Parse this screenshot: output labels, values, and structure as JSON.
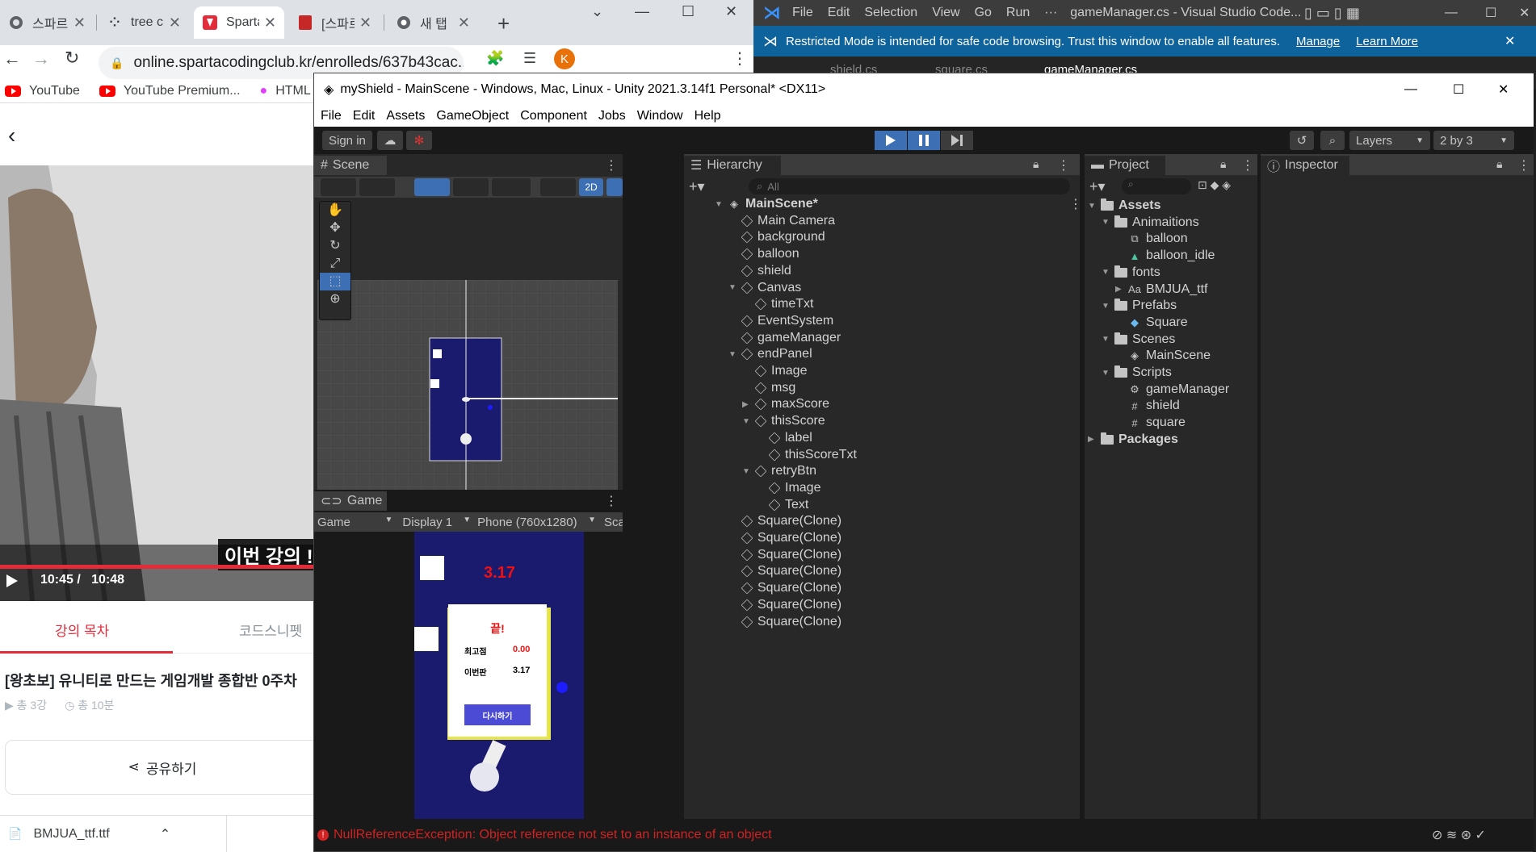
{
  "chrome": {
    "tabs": [
      {
        "label": "스파르",
        "active": false
      },
      {
        "label": "tree c",
        "active": false
      },
      {
        "label": "Sparta",
        "active": true
      },
      {
        "label": "[스파르",
        "active": false
      },
      {
        "label": "새 탭",
        "active": false
      }
    ],
    "url": "online.spartacodingclub.kr/enrolleds/637b43cac...",
    "bookmarks": [
      "YouTube",
      "YouTube Premium...",
      "HTML Tag"
    ],
    "video": {
      "caption": "이번 강의 !",
      "time_current": "10:45 /",
      "time_total": "10:48",
      "progress_fraction": 0.99
    },
    "lesson_tabs": {
      "toc": "강의 목차",
      "snippets": "코드스니펫"
    },
    "course_title": "[왕초보] 유니티로 만드는 게임개발 종합반 0주차",
    "course_meta": {
      "lessons": "총 3강",
      "duration": "총 10분"
    },
    "share_label": "공유하기",
    "download": {
      "filename": "BMJUA_ttf.ttf"
    },
    "avatar_letter": "K"
  },
  "vscode": {
    "menu": [
      "File",
      "Edit",
      "Selection",
      "View",
      "Go",
      "Run",
      "···"
    ],
    "title": "gameManager.cs - Visual Studio Code...",
    "banner": {
      "text": "Restricted Mode is intended for safe code browsing. Trust this window to enable all features.",
      "manage": "Manage",
      "learn_more": "Learn More"
    },
    "tabs": [
      "shield.cs",
      "square.cs",
      "gameManager.cs"
    ]
  },
  "unity": {
    "title": "myShield - MainScene - Windows, Mac, Linux - Unity 2021.3.14f1 Personal* <DX11>",
    "menu": [
      "File",
      "Edit",
      "Assets",
      "GameObject",
      "Component",
      "Jobs",
      "Window",
      "Help"
    ],
    "toolbar": {
      "sign_in": "Sign in",
      "layers": "Layers",
      "layout": "2 by 3"
    },
    "scene_tab": "Scene",
    "scene_2d_label": "2D",
    "game_tab": "Game",
    "game_bar": {
      "mode": "Game",
      "display": "Display 1",
      "resolution": "Phone (760x1280)",
      "scale": "Sca"
    },
    "game": {
      "timer": "3.17",
      "panel_title": "끝!",
      "best_label": "최고점",
      "best_value": "0.00",
      "this_label": "이번판",
      "this_value": "3.17",
      "retry_label": "다시하기"
    },
    "hierarchy_tab": "Hierarchy",
    "hierarchy_search": "All",
    "hierarchy": [
      {
        "label": "MainScene*",
        "depth": 0,
        "arrow": "open",
        "icon": "unity-logo-icon",
        "bold": true
      },
      {
        "label": "Main Camera",
        "depth": 1,
        "arrow": "",
        "icon": "cube"
      },
      {
        "label": "background",
        "depth": 1,
        "arrow": "",
        "icon": "cube"
      },
      {
        "label": "balloon",
        "depth": 1,
        "arrow": "",
        "icon": "cube"
      },
      {
        "label": "shield",
        "depth": 1,
        "arrow": "",
        "icon": "cube"
      },
      {
        "label": "Canvas",
        "depth": 1,
        "arrow": "open",
        "icon": "cube"
      },
      {
        "label": "timeTxt",
        "depth": 2,
        "arrow": "",
        "icon": "cube"
      },
      {
        "label": "EventSystem",
        "depth": 1,
        "arrow": "",
        "icon": "cube"
      },
      {
        "label": "gameManager",
        "depth": 1,
        "arrow": "",
        "icon": "cube"
      },
      {
        "label": "endPanel",
        "depth": 1,
        "arrow": "open",
        "icon": "cube"
      },
      {
        "label": "Image",
        "depth": 2,
        "arrow": "",
        "icon": "cube"
      },
      {
        "label": "msg",
        "depth": 2,
        "arrow": "",
        "icon": "cube"
      },
      {
        "label": "maxScore",
        "depth": 2,
        "arrow": "closed",
        "icon": "cube"
      },
      {
        "label": "thisScore",
        "depth": 2,
        "arrow": "open",
        "icon": "cube"
      },
      {
        "label": "label",
        "depth": 3,
        "arrow": "",
        "icon": "cube"
      },
      {
        "label": "thisScoreTxt",
        "depth": 3,
        "arrow": "",
        "icon": "cube"
      },
      {
        "label": "retryBtn",
        "depth": 2,
        "arrow": "open",
        "icon": "cube"
      },
      {
        "label": "Image",
        "depth": 3,
        "arrow": "",
        "icon": "cube"
      },
      {
        "label": "Text",
        "depth": 3,
        "arrow": "",
        "icon": "cube"
      },
      {
        "label": "Square(Clone)",
        "depth": 1,
        "arrow": "",
        "icon": "cube"
      },
      {
        "label": "Square(Clone)",
        "depth": 1,
        "arrow": "",
        "icon": "cube"
      },
      {
        "label": "Square(Clone)",
        "depth": 1,
        "arrow": "",
        "icon": "cube"
      },
      {
        "label": "Square(Clone)",
        "depth": 1,
        "arrow": "",
        "icon": "cube"
      },
      {
        "label": "Square(Clone)",
        "depth": 1,
        "arrow": "",
        "icon": "cube"
      },
      {
        "label": "Square(Clone)",
        "depth": 1,
        "arrow": "",
        "icon": "cube"
      },
      {
        "label": "Square(Clone)",
        "depth": 1,
        "arrow": "",
        "icon": "cube"
      }
    ],
    "project_tab": "Project",
    "project": [
      {
        "label": "Assets",
        "depth": 0,
        "arrow": "open",
        "icon": "folder",
        "bold": true
      },
      {
        "label": "Animaitions",
        "depth": 1,
        "arrow": "open",
        "icon": "folder"
      },
      {
        "label": "balloon",
        "depth": 2,
        "arrow": "",
        "icon": "animator-icon"
      },
      {
        "label": "balloon_idle",
        "depth": 2,
        "arrow": "",
        "icon": "animation-clip-icon"
      },
      {
        "label": "fonts",
        "depth": 1,
        "arrow": "open",
        "icon": "folder"
      },
      {
        "label": "BMJUA_ttf",
        "depth": 2,
        "arrow": "closed",
        "icon": "font-icon"
      },
      {
        "label": "Prefabs",
        "depth": 1,
        "arrow": "open",
        "icon": "folder"
      },
      {
        "label": "Square",
        "depth": 2,
        "arrow": "",
        "icon": "prefab-icon"
      },
      {
        "label": "Scenes",
        "depth": 1,
        "arrow": "open",
        "icon": "folder"
      },
      {
        "label": "MainScene",
        "depth": 2,
        "arrow": "",
        "icon": "unity-logo-icon"
      },
      {
        "label": "Scripts",
        "depth": 1,
        "arrow": "open",
        "icon": "folder"
      },
      {
        "label": "gameManager",
        "depth": 2,
        "arrow": "",
        "icon": "gear-script-icon"
      },
      {
        "label": "shield",
        "depth": 2,
        "arrow": "",
        "icon": "script-icon"
      },
      {
        "label": "square",
        "depth": 2,
        "arrow": "",
        "icon": "script-icon"
      },
      {
        "label": "Packages",
        "depth": 0,
        "arrow": "closed",
        "icon": "folder",
        "bold": true
      }
    ],
    "inspector_tab": "Inspector",
    "error": "NullReferenceException: Object reference not set to an instance of an object"
  },
  "colors": {
    "spartan_red": "#e42b39",
    "unity_dark": "#282828",
    "vscode_blue": "#0e639c",
    "game_navy": "#1a1a6e",
    "error_red": "#d32222"
  }
}
